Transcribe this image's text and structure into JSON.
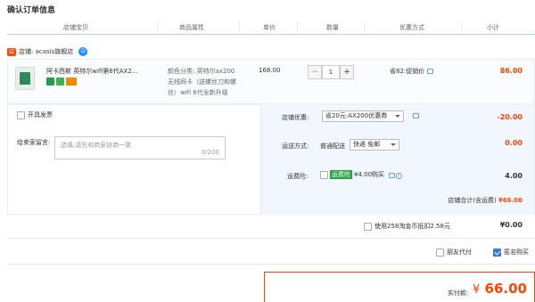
{
  "page": {
    "title": "确认订单信息"
  },
  "columns": [
    "店铺宝贝",
    "商品属性",
    "单价",
    "数量",
    "优惠方式",
    "小计"
  ],
  "store": {
    "label": "店铺: acasis旗舰店"
  },
  "item": {
    "name": "阿卡西斯 英特尔wifi第6代AX2...",
    "attributes": "颜色分类: 英特尔ax200无线网卡（送螺丝刀和螺丝）wifi 6代全新升级",
    "price": "168.00",
    "quantity": "1",
    "minus": "−",
    "plus": "+",
    "discount": "省82:促销价",
    "subtotal": "86.00"
  },
  "invoice": {
    "label": "开具发票"
  },
  "message": {
    "label": "给卖家留言:",
    "placeholder": "选填,请先和商家协商一致",
    "counter": "0/200"
  },
  "store_coupon": {
    "label": "店铺优惠:",
    "value": "省20元:AX200优惠券",
    "amount": "-20.00"
  },
  "shipping": {
    "label": "运送方式:",
    "method": "普通配送",
    "option": "快递 免邮",
    "amount": "0.00"
  },
  "insurance": {
    "label": "运费险:",
    "tag": "运费险",
    "value": "¥4.00购买",
    "amount": "4.00"
  },
  "store_total": {
    "label": "店铺合计(含运费)",
    "amount": "¥66.00"
  },
  "taojin": {
    "label": "使用258淘金币抵扣2.58元",
    "amount": "¥0.00"
  },
  "friend_pay": {
    "label": "朋友代付"
  },
  "anonymous": {
    "label": "匿名购买"
  },
  "payment": {
    "label": "实付款:",
    "currency": "¥",
    "amount": "66.00"
  },
  "colors": {
    "accent": "#ff4400",
    "blue": "#3478e0"
  }
}
